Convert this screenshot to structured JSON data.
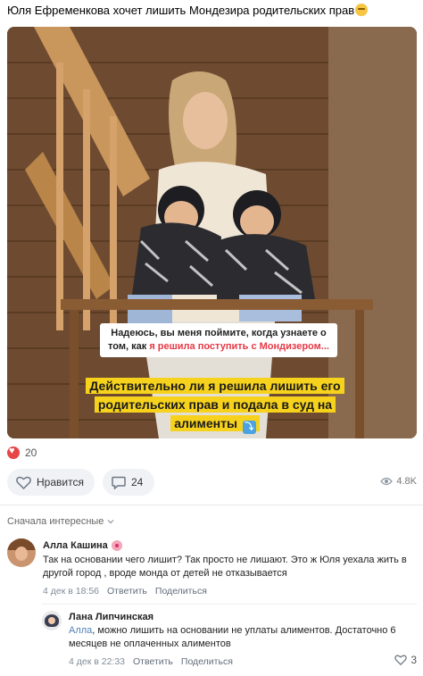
{
  "post": {
    "title": "Юля Ефременкова хочет лишить Мондезира родительских прав",
    "image": {
      "caption_top_1": "Надеюсь, вы меня поймите, когда узнаете о",
      "caption_top_2_pre": "том, как ",
      "caption_top_2_hl": "я решила поступить с Мондизером...",
      "caption_main_1": "Действительно ли я решила лишить его",
      "caption_main_2": "родительских прав и подала в суд на",
      "caption_main_3": "алименты"
    },
    "reactions_count": "20",
    "like_label": "Нравится",
    "comments_count": "24",
    "views": "4.8K"
  },
  "comments": {
    "sort_label": "Сначала интересные",
    "items": [
      {
        "author": "Алла Кашина",
        "text": "Так на основании чего лишит? Так просто не лишают. Это ж Юля уехала жить в другой город , вроде монда от детей не отказывается",
        "date": "4 дек в 18:56",
        "reply_label": "Ответить",
        "share_label": "Поделиться"
      },
      {
        "author": "Лана Липчинская",
        "reply_to": "Алла",
        "text": ", можно лишить на основании не уплаты алиментов. Достаточно 6 месяцев не оплаченных алиментов",
        "date": "4 дек в 22:33",
        "reply_label": "Ответить",
        "share_label": "Поделиться",
        "likes": "3"
      }
    ]
  },
  "colors": {
    "accent_red": "#e64646",
    "caption_yellow": "#f7d21c",
    "link_blue": "#5181b8"
  }
}
